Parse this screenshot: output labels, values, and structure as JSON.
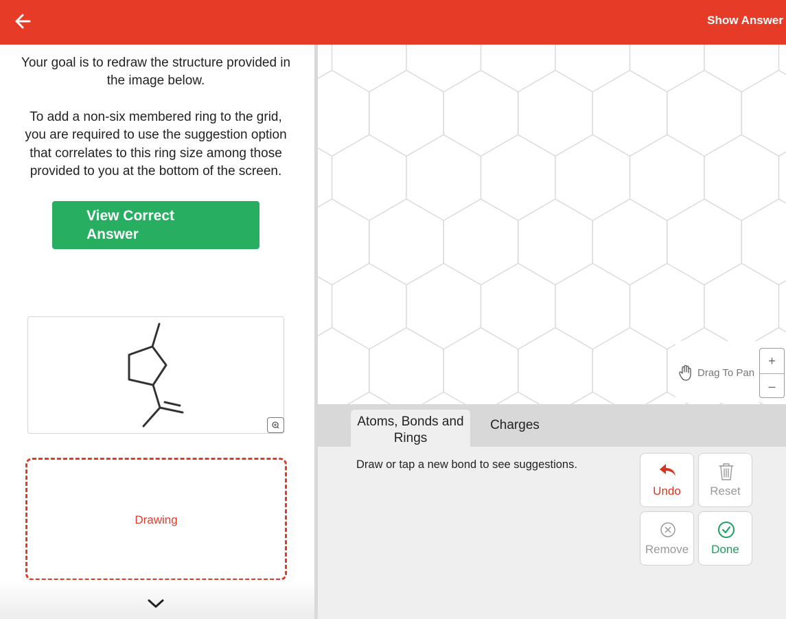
{
  "header": {
    "back_icon": "arrow-left-icon",
    "show_answer_label": "Show Answer",
    "background_color": "#e63b27"
  },
  "instructions": {
    "goal": "Your goal is to redraw the structure provided in the image below.",
    "ring_hint": "To add a non-six membered ring to the grid, you are required to use the suggestion option that correlates to this ring size among those provided to you at the bottom of the screen."
  },
  "view_answer": {
    "label": "View Correct Answer",
    "color": "#27ae60"
  },
  "molecule_preview": {
    "zoom_icon": "magnify-plus-icon"
  },
  "drawing": {
    "label": "Drawing",
    "accent_color": "#e23a2a"
  },
  "canvas": {
    "pan_label": "Drag To Pan",
    "pan_icon": "hand-icon",
    "zoom_in_label": "+",
    "zoom_out_label": "–"
  },
  "tabs": [
    {
      "label": "Atoms, Bonds and Rings",
      "active": true
    },
    {
      "label": "Charges",
      "active": false
    }
  ],
  "panel": {
    "hint": "Draw or tap a new bond to see suggestions."
  },
  "actions": {
    "undo": {
      "label": "Undo",
      "icon": "undo-icon",
      "color": "#d9341f"
    },
    "reset": {
      "label": "Reset",
      "icon": "trash-icon",
      "color": "#999999"
    },
    "remove": {
      "label": "Remove",
      "icon": "close-circle-icon",
      "color": "#999999"
    },
    "done": {
      "label": "Done",
      "icon": "check-circle-icon",
      "color": "#1a9e5c"
    }
  }
}
